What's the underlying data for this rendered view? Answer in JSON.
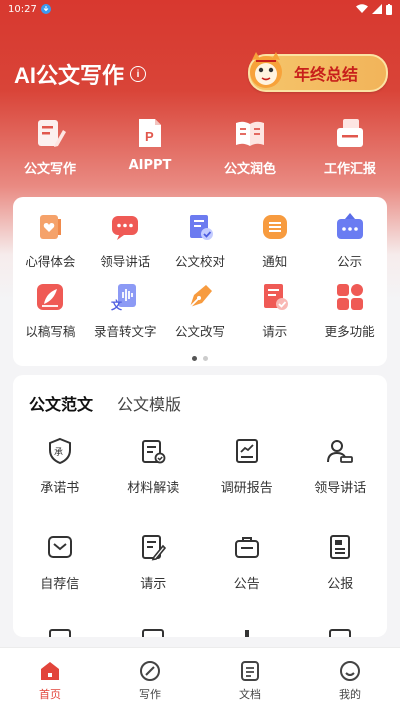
{
  "status": {
    "time": "10:27"
  },
  "header": {
    "title": "AI公文写作",
    "banner_text": "年终总结"
  },
  "top_tools": [
    {
      "label": "公文写作",
      "icon": "pen-document-icon"
    },
    {
      "label": "AIPPT",
      "icon": "ppt-file-icon"
    },
    {
      "label": "公文润色",
      "icon": "open-book-icon"
    },
    {
      "label": "工作汇报",
      "icon": "report-stack-icon"
    }
  ],
  "features": [
    {
      "label": "心得体会",
      "icon": "heart-notebook-icon"
    },
    {
      "label": "领导讲话",
      "icon": "speech-bubble-icon"
    },
    {
      "label": "公文校对",
      "icon": "check-document-icon"
    },
    {
      "label": "通知",
      "icon": "notice-icon"
    },
    {
      "label": "公示",
      "icon": "board-icon"
    },
    {
      "label": "以稿写稿",
      "icon": "quill-icon"
    },
    {
      "label": "录音转文字",
      "icon": "audio-text-icon"
    },
    {
      "label": "公文改写",
      "icon": "fountain-pen-icon"
    },
    {
      "label": "请示",
      "icon": "request-doc-icon"
    },
    {
      "label": "更多功能",
      "icon": "apps-grid-icon"
    }
  ],
  "section": {
    "tabs": [
      "公文范文",
      "公文模版"
    ],
    "items": [
      {
        "label": "承诺书",
        "icon": "promise-shield-icon"
      },
      {
        "label": "材料解读",
        "icon": "clipboard-check-icon"
      },
      {
        "label": "调研报告",
        "icon": "chart-doc-icon"
      },
      {
        "label": "领导讲话",
        "icon": "speaker-person-icon"
      },
      {
        "label": "自荐信",
        "icon": "envelope-icon"
      },
      {
        "label": "请示",
        "icon": "edit-doc-icon"
      },
      {
        "label": "公告",
        "icon": "briefcase-icon"
      },
      {
        "label": "公报",
        "icon": "bulletin-icon"
      }
    ]
  },
  "bottom_nav": [
    {
      "label": "首页",
      "icon": "home-icon"
    },
    {
      "label": "写作",
      "icon": "compose-icon"
    },
    {
      "label": "文档",
      "icon": "document-icon"
    },
    {
      "label": "我的",
      "icon": "profile-icon"
    }
  ],
  "colors": {
    "brand_red": "#d8382f",
    "active_nav": "#e2453b"
  }
}
